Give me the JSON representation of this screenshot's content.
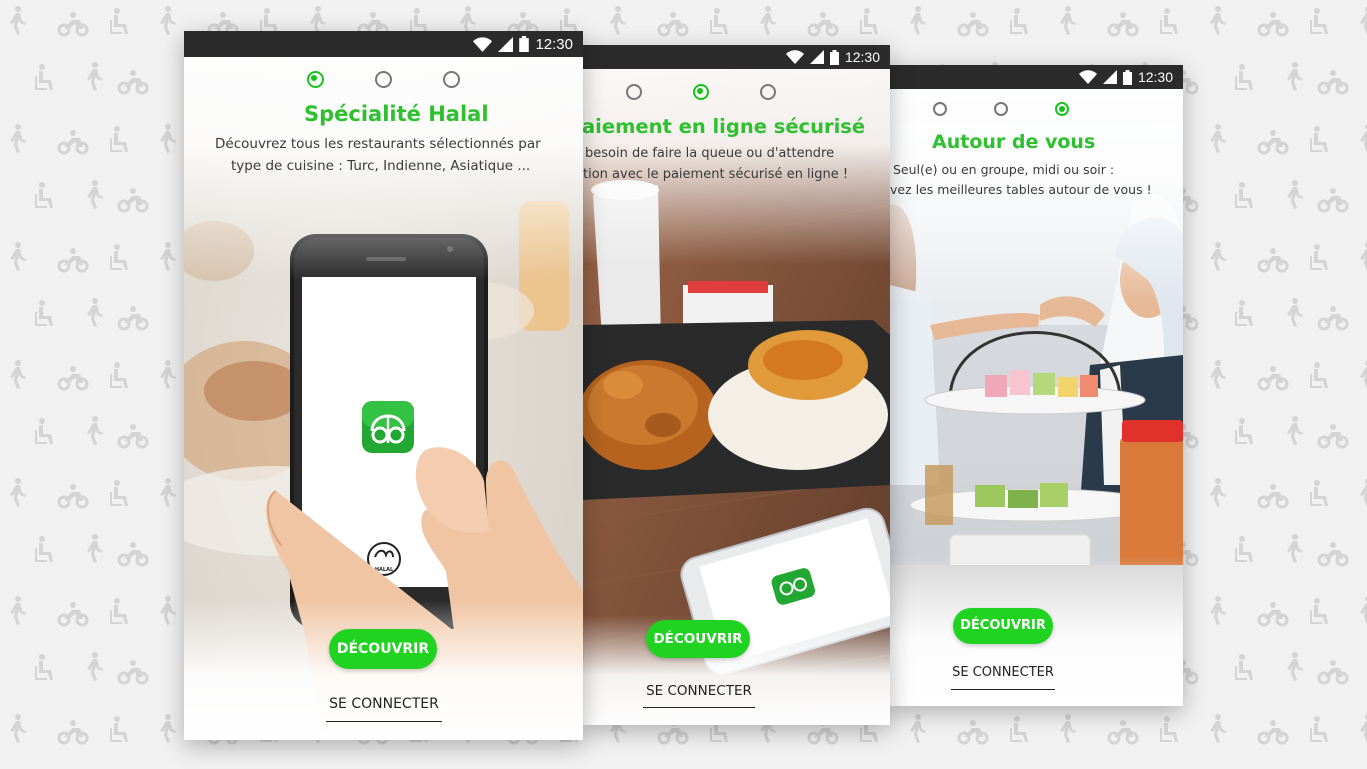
{
  "statusbar": {
    "time": "12:30"
  },
  "screens": [
    {
      "title": "Spécialité Halal",
      "description_lines": [
        "Découvrez tous les restaurants sélectionnés par",
        "type de cuisine : Turc, Indienne, Asiatique ..."
      ],
      "active_step": 1,
      "discover_label": "DÉCOUVRIR",
      "login_label": "SE CONNECTER",
      "badge_text": "HALAL"
    },
    {
      "title": "aiement en ligne sécurisé",
      "description_lines": [
        "besoin de faire la queue ou d'attendre",
        "tion avec le paiement sécurisé en ligne !"
      ],
      "active_step": 2,
      "discover_label": "DÉCOUVRIR",
      "login_label": "SE CONNECTER"
    },
    {
      "title": "Autour de vous",
      "description_lines": [
        "Seul(e) ou en groupe, midi ou soir :",
        "vez les meilleures tables autour de vous !"
      ],
      "active_step": 3,
      "discover_label": "DÉCOUVRIR",
      "login_label": "SE CONNECTER"
    }
  ],
  "colors": {
    "accent": "#21d321",
    "title_green": "#2ec02e",
    "statusbar": "#2b2b2b"
  },
  "icons": [
    "wifi-icon",
    "signal-icon",
    "battery-icon",
    "app-logo-icon",
    "halal-badge-icon",
    "walker-icon",
    "motorbike-icon",
    "wheelchair-icon"
  ]
}
